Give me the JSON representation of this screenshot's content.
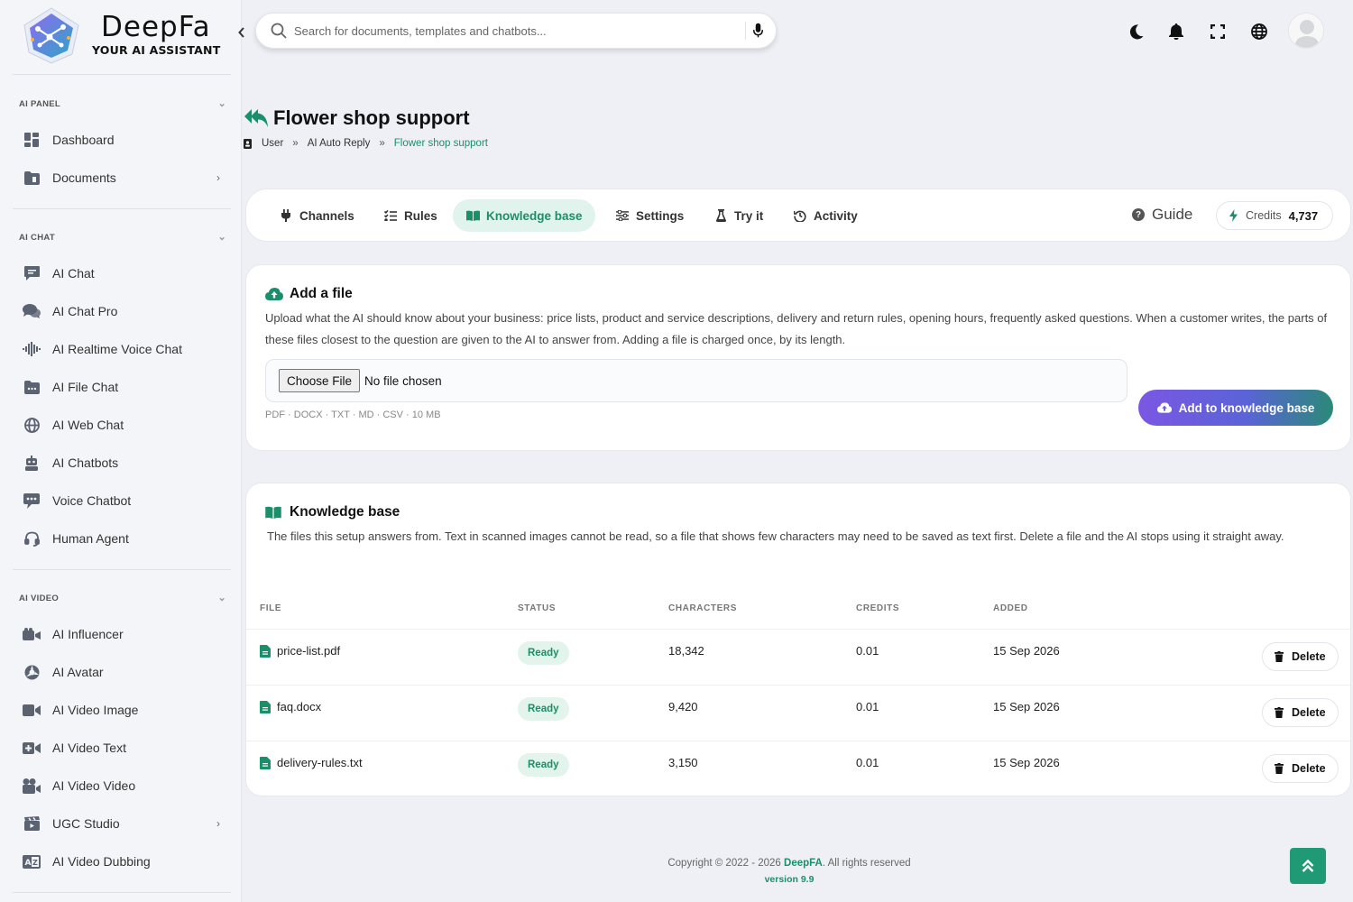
{
  "brand": {
    "name": "DeepFa",
    "tagline": "YOUR AI ASSISTANT"
  },
  "sidebar": {
    "sections": [
      {
        "title": "AI PANEL",
        "items": [
          {
            "label": "Dashboard",
            "icon": "dashboard-icon",
            "has_arrow": false
          },
          {
            "label": "Documents",
            "icon": "folder-icon",
            "has_arrow": true
          }
        ]
      },
      {
        "title": "AI CHAT",
        "items": [
          {
            "label": "AI Chat",
            "icon": "chat-icon"
          },
          {
            "label": "AI Chat Pro",
            "icon": "comments-icon"
          },
          {
            "label": "AI Realtime Voice Chat",
            "icon": "waveform-icon"
          },
          {
            "label": "AI File Chat",
            "icon": "folder-chat-icon"
          },
          {
            "label": "AI Web Chat",
            "icon": "globe-icon"
          },
          {
            "label": "AI Chatbots",
            "icon": "robot-icon"
          },
          {
            "label": "Voice Chatbot",
            "icon": "voice-bot-icon"
          },
          {
            "label": "Human Agent",
            "icon": "headset-icon"
          }
        ]
      },
      {
        "title": "AI VIDEO",
        "items": [
          {
            "label": "AI Influencer",
            "icon": "camera-icon"
          },
          {
            "label": "AI Avatar",
            "icon": "avatar-spin-icon"
          },
          {
            "label": "AI Video Image",
            "icon": "video-icon"
          },
          {
            "label": "AI Video Text",
            "icon": "video-plus-icon"
          },
          {
            "label": "AI Video Video",
            "icon": "film-camera-icon"
          },
          {
            "label": "UGC Studio",
            "icon": "clapper-icon",
            "has_arrow": true
          },
          {
            "label": "AI Video Dubbing",
            "icon": "translate-icon"
          }
        ]
      }
    ]
  },
  "topbar": {
    "search_placeholder": "Search for documents, templates and chatbots...",
    "icons": [
      "moon-icon",
      "bell-icon",
      "fullscreen-icon",
      "globe-icon",
      "user-avatar"
    ]
  },
  "page": {
    "title": "Flower shop support",
    "breadcrumb": [
      "User",
      "AI Auto Reply",
      "Flower shop support"
    ]
  },
  "tabs": [
    {
      "label": "Channels",
      "icon": "plug-icon",
      "active": false
    },
    {
      "label": "Rules",
      "icon": "list-check-icon",
      "active": false
    },
    {
      "label": "Knowledge base",
      "icon": "book-icon",
      "active": true
    },
    {
      "label": "Settings",
      "icon": "sliders-icon",
      "active": false
    },
    {
      "label": "Try it",
      "icon": "flask-icon",
      "active": false
    },
    {
      "label": "Activity",
      "icon": "history-icon",
      "active": false
    }
  ],
  "guide_label": "Guide",
  "credits": {
    "label": "Credits",
    "value": "4,737"
  },
  "add_file": {
    "title": "Add a file",
    "description": "Upload what the AI should know about your business: price lists, product and service descriptions, delivery and return rules, opening hours, frequently asked questions. When a customer writes, the parts of these files closest to the question are given to the AI to answer from. Adding a file is charged once, by its length.",
    "choose_label": "Choose File",
    "no_file_label": "No file chosen",
    "hint": "PDF · DOCX · TXT · MD · CSV · 10 MB",
    "submit_label": "Add to knowledge base"
  },
  "knowledge_base": {
    "title": "Knowledge base",
    "description": "The files this setup answers from. Text in scanned images cannot be read, so a file that shows few characters may need to be saved as text first. Delete a file and the AI stops using it straight away.",
    "columns": [
      "FILE",
      "STATUS",
      "CHARACTERS",
      "CREDITS",
      "ADDED"
    ],
    "rows": [
      {
        "file": "price-list.pdf",
        "status": "Ready",
        "characters": "18,342",
        "credits": "0.01",
        "added": "15 Sep 2026"
      },
      {
        "file": "faq.docx",
        "status": "Ready",
        "characters": "9,420",
        "credits": "0.01",
        "added": "15 Sep 2026"
      },
      {
        "file": "delivery-rules.txt",
        "status": "Ready",
        "characters": "3,150",
        "credits": "0.01",
        "added": "15 Sep 2026"
      }
    ],
    "delete_label": "Delete"
  },
  "footer": {
    "copy_prefix": "Copyright © 2022 - 2026",
    "brand": "DeepFA",
    "copy_suffix": ". All rights reserved",
    "version": "version 9.9"
  },
  "colors": {
    "accent": "#1a8f6a",
    "gradient_start": "#7b57e3",
    "gradient_end": "#2a8a78"
  }
}
